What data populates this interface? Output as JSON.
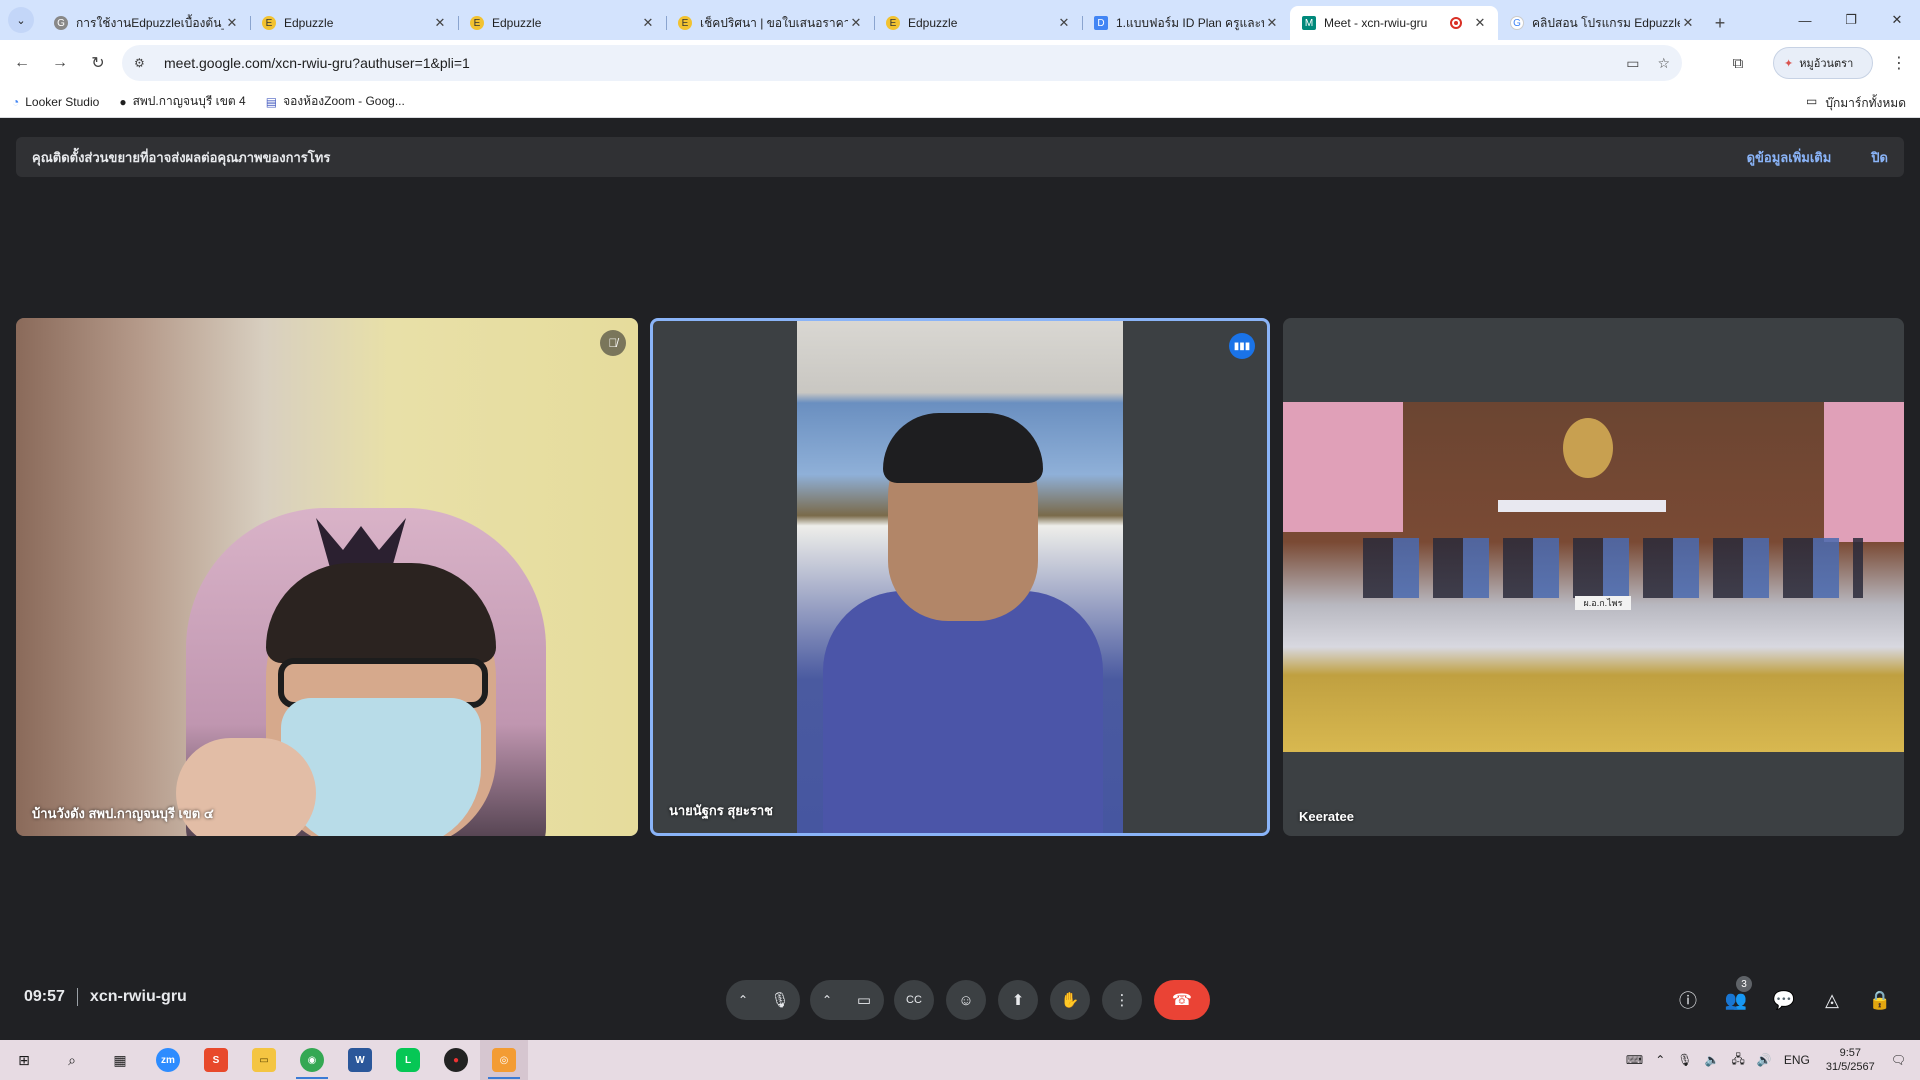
{
  "browser": {
    "tabs": [
      {
        "title": "การใช้งานEdpuzzleเบื้องต้น_",
        "fav": "G",
        "active": false
      },
      {
        "title": "Edpuzzle",
        "fav": "E",
        "active": false
      },
      {
        "title": "Edpuzzle",
        "fav": "E",
        "active": false
      },
      {
        "title": "เช็คปริศนา | ขอใบเสนอราคา",
        "fav": "E",
        "active": false
      },
      {
        "title": "Edpuzzle",
        "fav": "E",
        "active": false
      },
      {
        "title": "1.แบบฟอร์ม ID Plan ครูและบุ",
        "fav": "D",
        "active": false
      },
      {
        "title": "Meet - xcn-rwiu-gru",
        "fav": "M",
        "active": true
      },
      {
        "title": "คลิปสอน โปรแกรม Edpuzzle",
        "fav": "G",
        "active": false
      }
    ],
    "url": "meet.google.com/xcn-rwiu-gru?authuser=1&pli=1",
    "profile_label": "หมูอ้วนตรา",
    "bookmarks": [
      {
        "label": "Looker Studio",
        "icon": "looker-icon"
      },
      {
        "label": "สพป.กาญจนบุรี เขต 4",
        "icon": "web-icon"
      },
      {
        "label": "จองห้องZoom - Goog...",
        "icon": "forms-icon"
      }
    ],
    "all_bookmarks_label": "บุ๊กมาร์กทั้งหมด"
  },
  "banner": {
    "message": "คุณติดตั้งส่วนขยายที่อาจส่งผลต่อคุณภาพของการโทร",
    "learn_more": "ดูข้อมูลเพิ่มเติม",
    "close": "ปิด"
  },
  "participants": [
    {
      "name": "บ้านวังดัง สพป.กาญจนบุรี เขต ๔",
      "muted": true
    },
    {
      "name": "นายนัฐกร สุยะราช",
      "speaking": true
    },
    {
      "name": "Keeratee"
    }
  ],
  "room_sign": "ผ.อ.ก.ไพร",
  "meeting": {
    "time": "09:57",
    "code": "xcn-rwiu-gru",
    "people_count": "3"
  },
  "taskbar": {
    "lang": "ENG",
    "time": "9:57",
    "date": "31/5/2567"
  },
  "colors": {
    "accent": "#8ab4f8",
    "end_call": "#ea4335",
    "meet_bg": "#202124"
  }
}
